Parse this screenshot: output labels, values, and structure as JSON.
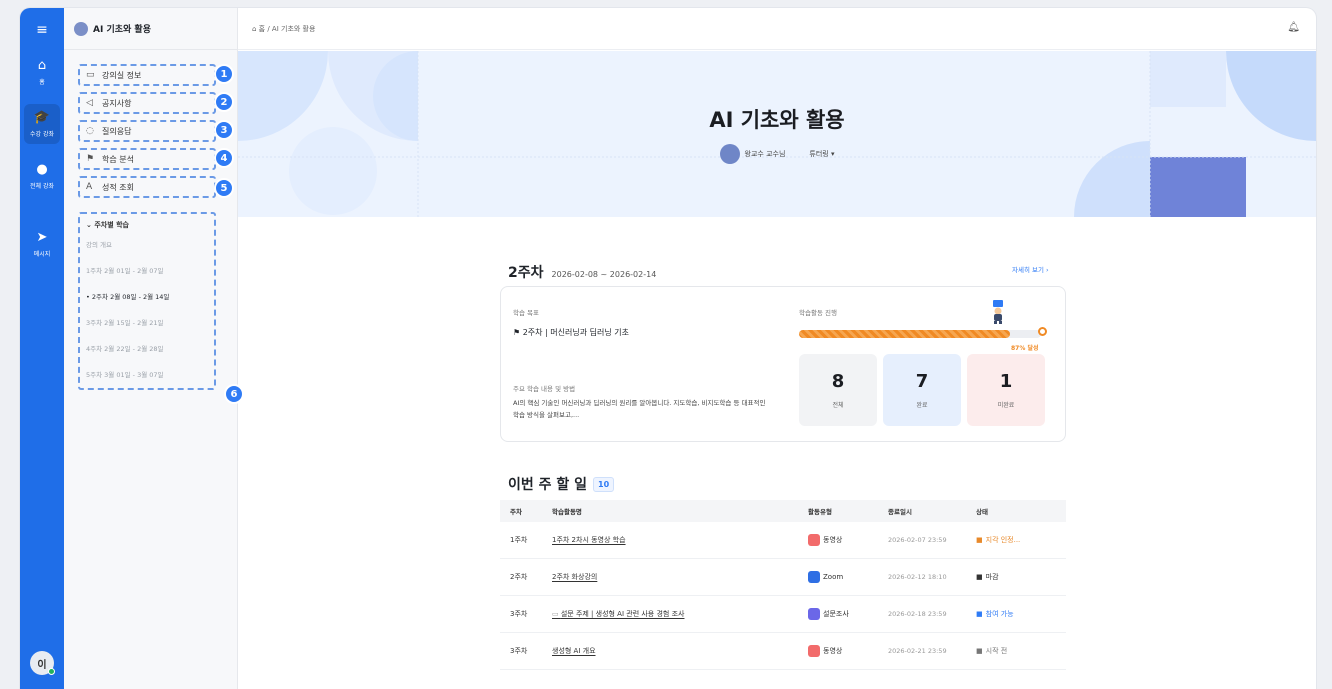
{
  "rail": {
    "menu_icon": "hamburger-icon",
    "items": [
      {
        "label": "홈",
        "icon": "home-icon"
      },
      {
        "label": "수강 강좌",
        "icon": "graduation-cap-icon"
      },
      {
        "label": "전체 강좌",
        "icon": "globe-icon"
      },
      {
        "label": "메시지",
        "icon": "paper-plane-icon"
      }
    ],
    "avatar_initial": "이"
  },
  "sidebar": {
    "course_title": "AI 기초와 활용",
    "menu": [
      {
        "label": "강의실 정보",
        "icon": "monitor-icon",
        "badge": "1"
      },
      {
        "label": "공지사항",
        "icon": "megaphone-icon",
        "badge": "2"
      },
      {
        "label": "질의응답",
        "icon": "chat-icon",
        "badge": "3"
      },
      {
        "label": "학습 분석",
        "icon": "flag-icon",
        "badge": "4"
      },
      {
        "label": "성적 조회",
        "icon": "grade-a-icon",
        "badge": "5"
      }
    ],
    "weekly": {
      "header": "주차별 학습",
      "badge": "6",
      "items": [
        "강의 개요",
        "1주차 2월 01일 - 2월 07일",
        "2주차 2월 08일 - 2월 14일",
        "3주차 2월 15일 - 2월 21일",
        "4주차 2월 22일 - 2월 28일",
        "5주차 3월 01일 - 3월 07일"
      ]
    }
  },
  "topbar": {
    "breadcrumb": "홈 / AI 기초와 활용",
    "bell_icon": "bell-icon"
  },
  "hero": {
    "title": "AI 기초와 활용",
    "professor": "왕교수 교수님",
    "tutoring": "튜터링 ▾"
  },
  "week": {
    "label": "2주차",
    "range": "2026-02-08 ~ 2026-02-14",
    "detail_link": "자세히 보기 ›",
    "goal_label": "학습 목표",
    "goal": "2주차 | 머신러닝과 딥러닝 기초",
    "desc_label": "주요 학습 내용 및 방법",
    "desc": "AI의 핵심 기술인 머신러닝과 딥러닝의 원리를 알아봅니다. 지도학습, 비지도학습 등 대표적인 학습 방식을 살펴보고,...",
    "progress_label": "학습활동 진행",
    "progress_value": 0.87,
    "progress_text": "87% 달성",
    "stats": [
      {
        "num": "8",
        "label": "전체"
      },
      {
        "num": "7",
        "label": "완료"
      },
      {
        "num": "1",
        "label": "미완료"
      }
    ]
  },
  "todo": {
    "title": "이번 주 할 일",
    "count": "10",
    "columns": [
      "주차",
      "학습활동명",
      "활동유형",
      "종료일시",
      "상태"
    ],
    "rows": [
      {
        "week": "1주차",
        "name": "1주차 2차시 동영상 학습",
        "type": "동영상",
        "type_color": "#f26b6b",
        "end": "2026-02-07 23:59",
        "status": "지각 인정...",
        "status_color": "#e8892a"
      },
      {
        "week": "2주차",
        "name": "2주차 화상강의",
        "type": "Zoom",
        "type_color": "#2f6fe4",
        "end": "2026-02-12 18:10",
        "status": "마감",
        "status_color": "#333333"
      },
      {
        "week": "3주차",
        "name": "설문 주제 | 생성형 AI 관련 사용 경험 조사",
        "type": "설문조사",
        "type_color": "#6b67e8",
        "end": "2026-02-18 23:59",
        "status": "참여 가능",
        "status_color": "#2f7bf5"
      },
      {
        "week": "3주차",
        "name": "생성형 AI 개요",
        "type": "동영상",
        "type_color": "#f26b6b",
        "end": "2026-02-21 23:59",
        "status": "시작 전",
        "status_color": "#777777"
      }
    ]
  }
}
